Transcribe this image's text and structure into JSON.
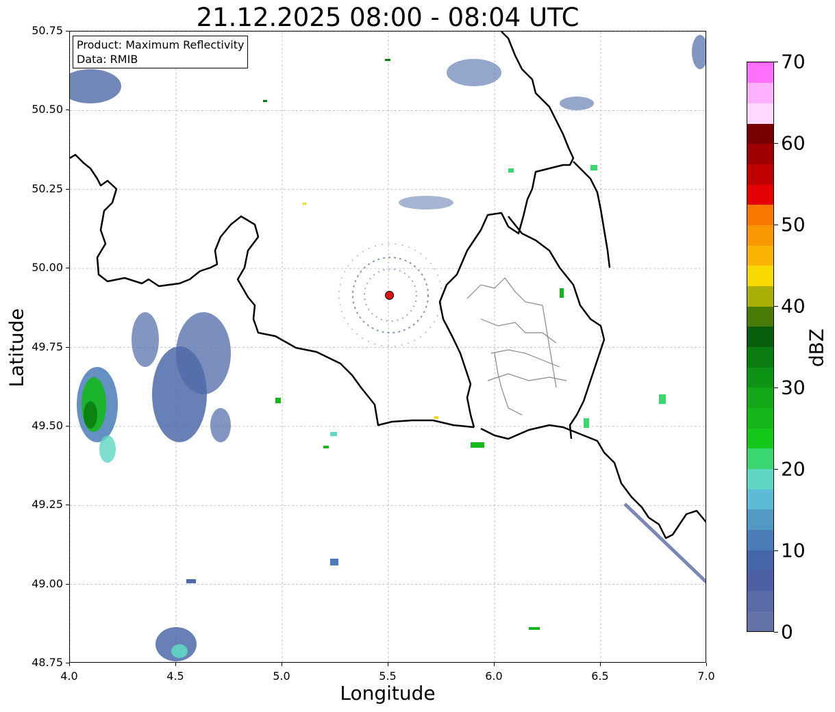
{
  "title": "21.12.2025 08:00 - 08:04 UTC",
  "info_box": {
    "product": "Product: Maximum Reflectivity",
    "data": "Data: RMIB"
  },
  "axes": {
    "xlabel": "Longitude",
    "ylabel": "Latitude",
    "xlim": [
      4.0,
      7.0
    ],
    "ylim": [
      48.75,
      50.75
    ],
    "xticks": [
      "4.0",
      "4.5",
      "5.0",
      "5.5",
      "6.0",
      "6.5",
      "7.0"
    ],
    "yticks": [
      "50.75",
      "50.50",
      "50.25",
      "50.00",
      "49.75",
      "49.50",
      "49.25",
      "49.00",
      "48.75"
    ],
    "grid": true
  },
  "colorbar": {
    "label": "dBZ",
    "range": [
      0,
      70
    ],
    "ticks": [
      "0",
      "10",
      "20",
      "30",
      "40",
      "50",
      "60",
      "70"
    ],
    "step": 2.5,
    "colors": [
      "#6474a8",
      "#5a6aa6",
      "#4e60a4",
      "#4466a8",
      "#4a7db8",
      "#509ac4",
      "#5cbcd8",
      "#5ed6c4",
      "#3ad670",
      "#14c81a",
      "#14b81a",
      "#12a818",
      "#0e9414",
      "#0a7c10",
      "#085e0a",
      "#4a7a08",
      "#aab008",
      "#f8d800",
      "#f8b400",
      "#f89800",
      "#f87800",
      "#e40000",
      "#c00000",
      "#a00000",
      "#780000",
      "#ffd8ff",
      "#ffb0ff",
      "#ff70ff",
      "#f040f0"
    ]
  },
  "radar_site": {
    "lon": 5.505,
    "lat": 49.915,
    "color": "#e01010"
  },
  "borders": {
    "color": "#000000",
    "internal_color": "#888888"
  }
}
